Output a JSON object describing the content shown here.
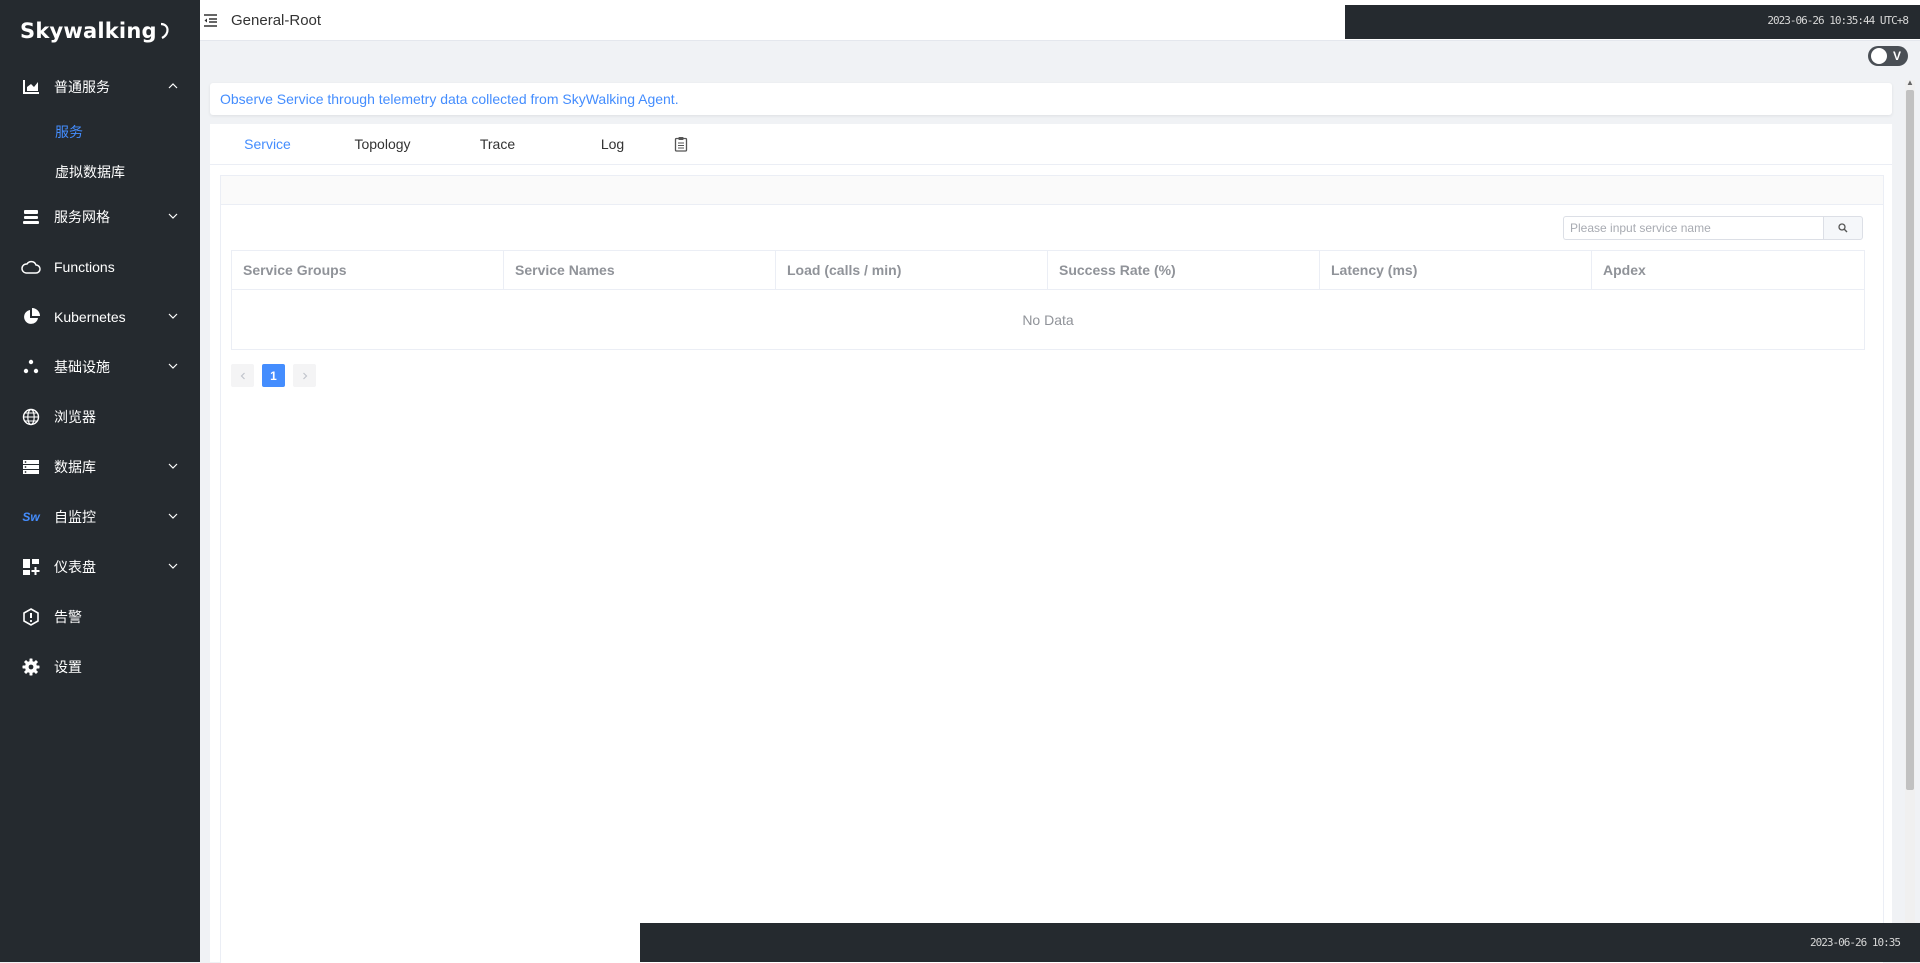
{
  "brand": {
    "name": "Skywalking"
  },
  "sidebar": {
    "items": [
      {
        "label": "普通服务",
        "icon": "bar-chart-icon",
        "expanded": true,
        "children": [
          {
            "label": "服务",
            "active": true
          },
          {
            "label": "虚拟数据库",
            "active": false
          }
        ]
      },
      {
        "label": "服务网格",
        "icon": "layers-icon",
        "expanded": false
      },
      {
        "label": "Functions",
        "icon": "cloud-icon"
      },
      {
        "label": "Kubernetes",
        "icon": "pie-chart-icon",
        "expanded": false
      },
      {
        "label": "基础设施",
        "icon": "dots-cluster-icon",
        "expanded": false
      },
      {
        "label": "浏览器",
        "icon": "globe-icon"
      },
      {
        "label": "数据库",
        "icon": "database-icon",
        "expanded": false
      },
      {
        "label": "自监控",
        "icon": "sw-logo-icon",
        "icon_text": "Sw",
        "expanded": false
      },
      {
        "label": "仪表盘",
        "icon": "dashboard-grid-icon",
        "expanded": false
      },
      {
        "label": "告警",
        "icon": "alert-shield-icon"
      },
      {
        "label": "设置",
        "icon": "gear-icon"
      }
    ]
  },
  "header": {
    "title": "General-Root",
    "overlay_text": "2023-06-26 10:35:44   UTC+8",
    "toggle_label": "V"
  },
  "main": {
    "description": "Observe Service through telemetry data collected from SkyWalking Agent.",
    "tabs": [
      {
        "label": "Service",
        "active": true
      },
      {
        "label": "Topology",
        "active": false
      },
      {
        "label": "Trace",
        "active": false
      },
      {
        "label": "Log",
        "active": false
      }
    ],
    "search": {
      "placeholder": "Please input service name",
      "value": ""
    },
    "table": {
      "columns": [
        "Service Groups",
        "Service Names",
        "Load (calls / min)",
        "Success Rate (%)",
        "Latency (ms)",
        "Apdex"
      ],
      "empty_text": "No Data"
    },
    "pagination": {
      "current": "1"
    }
  },
  "footer": {
    "overlay_text": "2023-06-26 10:35"
  },
  "colors": {
    "sidebar_bg": "#252a2f",
    "accent": "#448dfe",
    "page_bg": "#f0f2f5"
  }
}
